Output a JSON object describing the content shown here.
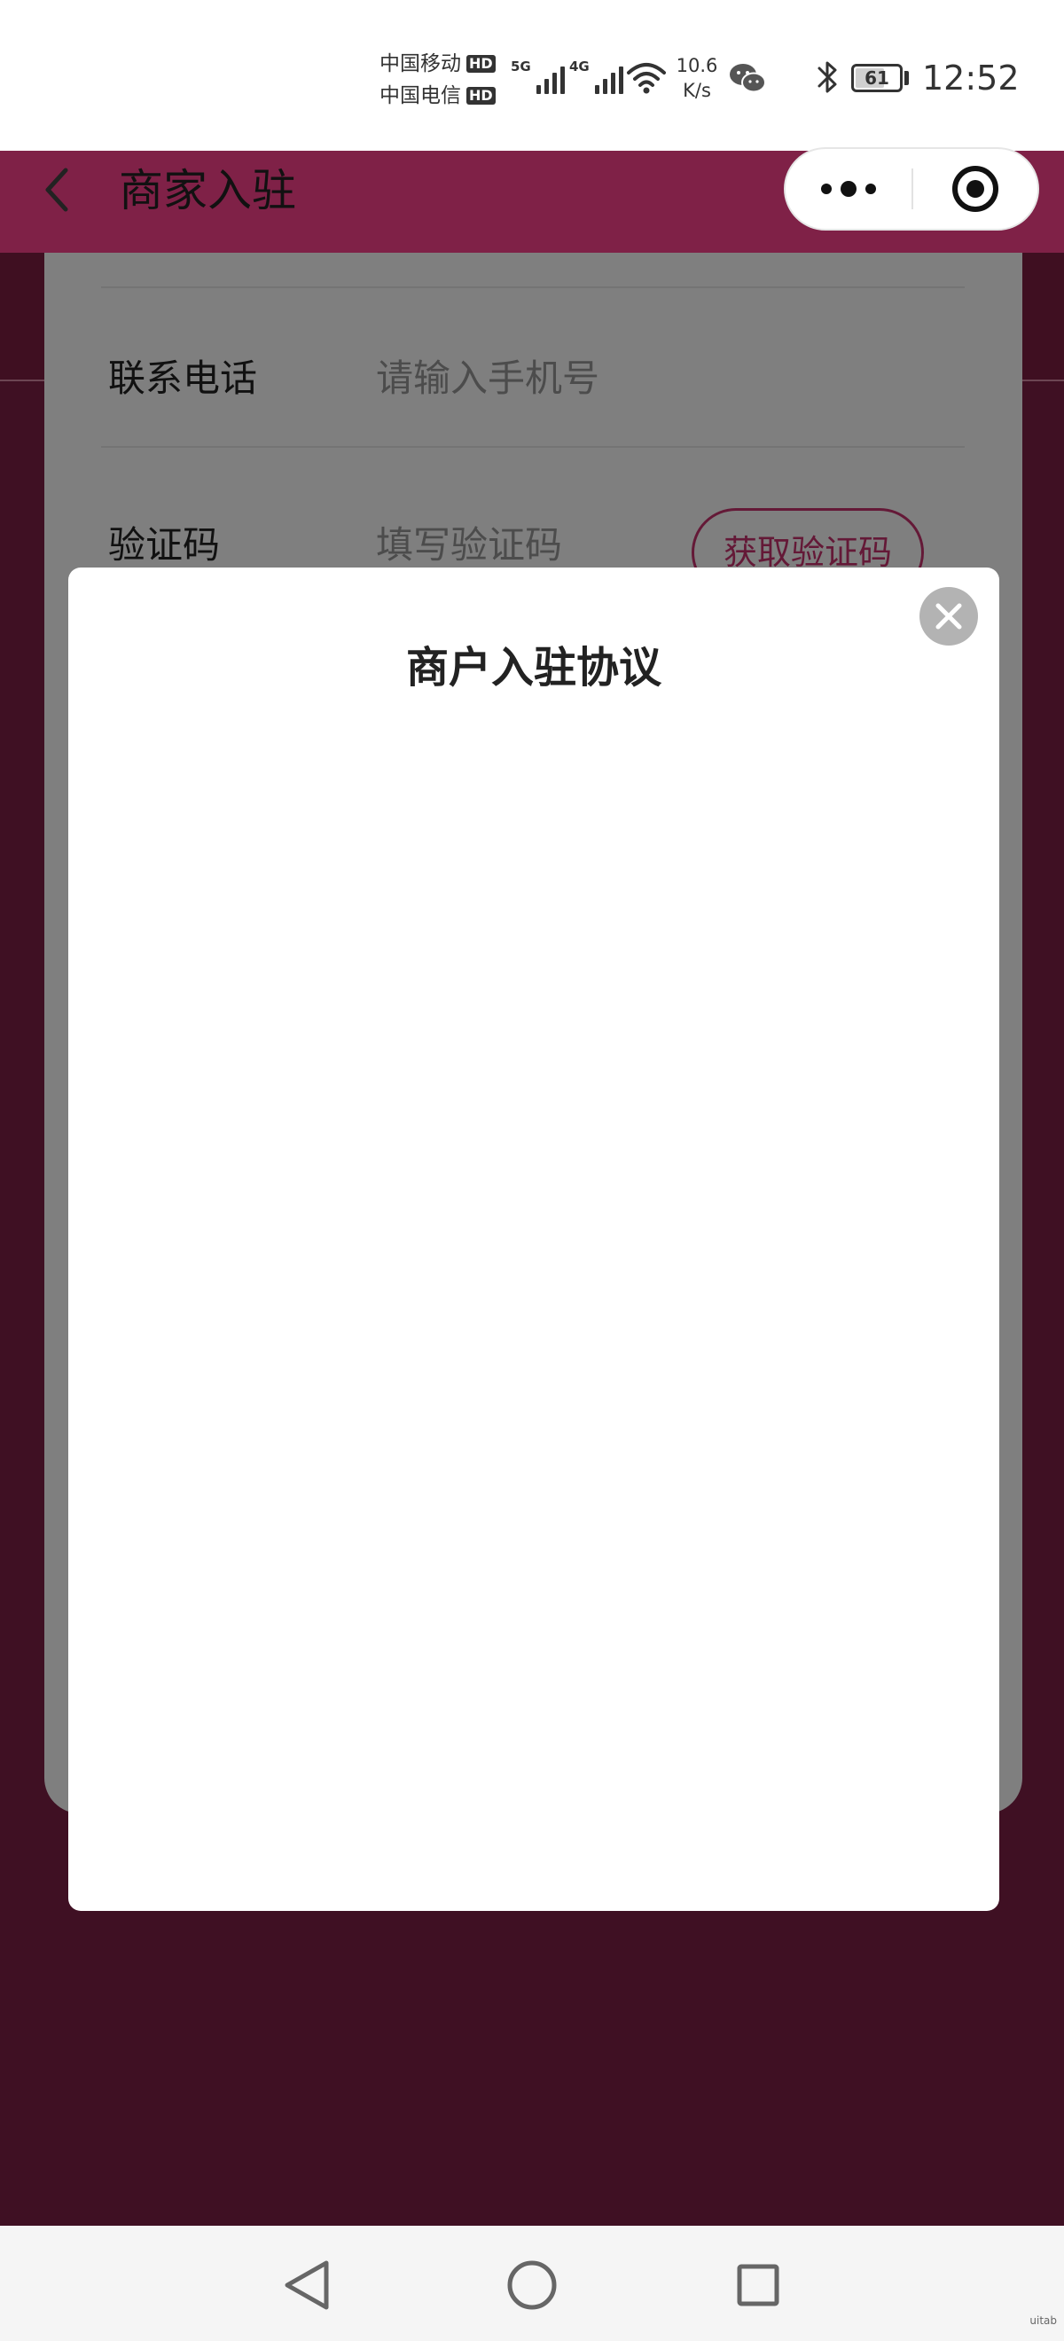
{
  "status_bar": {
    "carrier_1": "中国移动",
    "carrier_2": "中国电信",
    "hd_badge": "HD",
    "signal_1_label": "5G",
    "signal_2_label": "4G",
    "net_speed_value": "10.6",
    "net_speed_unit": "K/s",
    "battery_level": "61",
    "time": "12:52"
  },
  "header": {
    "title": "商家入驻",
    "back_icon": "chevron-left-icon",
    "more_icon": "more-dots-icon",
    "target_icon": "target-icon"
  },
  "form": {
    "phone_label": "联系电话",
    "phone_placeholder": "请输入手机号",
    "code_label": "验证码",
    "code_placeholder": "填写验证码",
    "get_code_button": "获取验证码"
  },
  "modal": {
    "title": "商户入驻协议",
    "close_icon": "close-icon"
  },
  "bottom_nav": {
    "back_icon": "triangle-back-icon",
    "home_icon": "circle-home-icon",
    "recent_icon": "square-recent-icon"
  },
  "watermark": "uitab",
  "colors": {
    "brand": "#7f2147",
    "accent": "#c8336e",
    "mask": "rgba(0,0,0,0.5)"
  }
}
